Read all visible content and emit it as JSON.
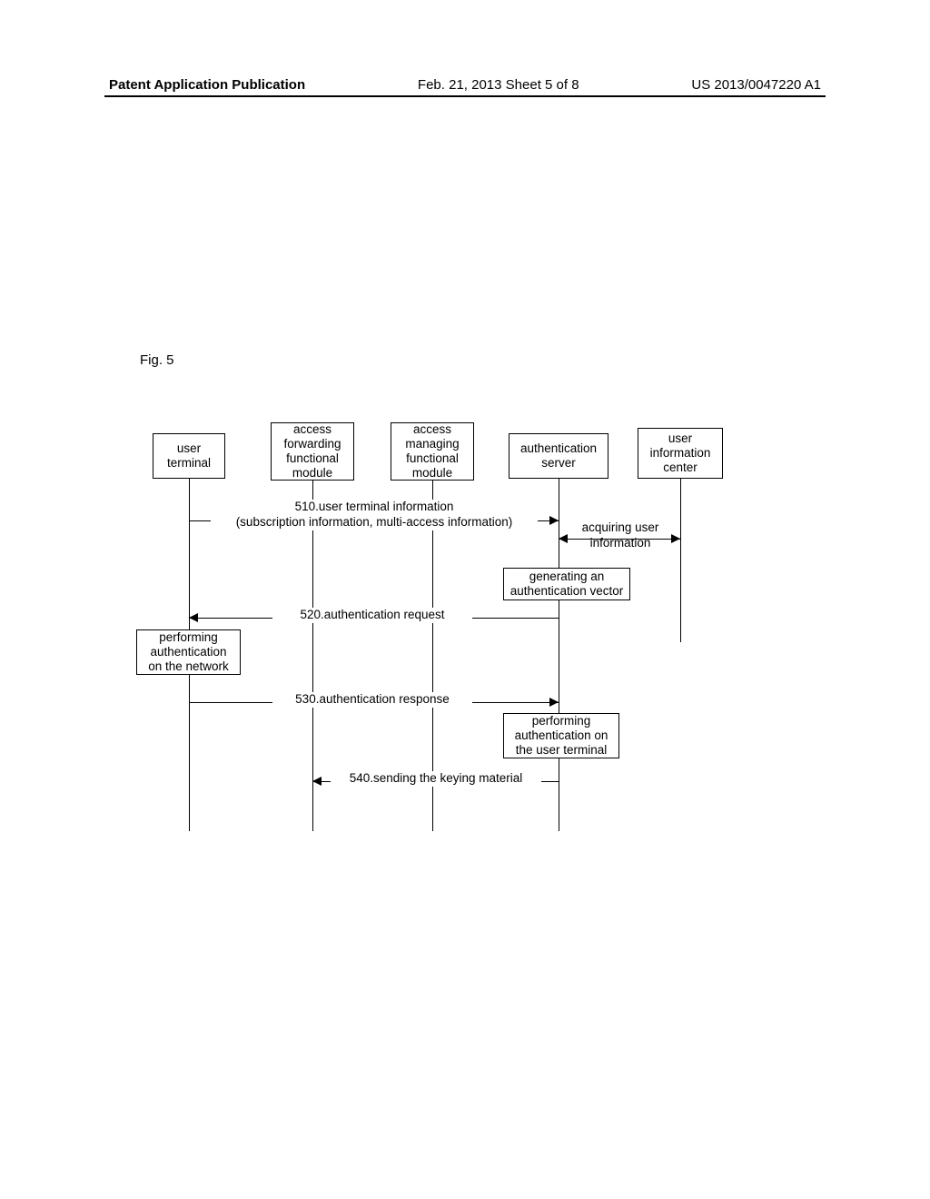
{
  "header": {
    "left": "Patent Application Publication",
    "middle": "Feb. 21, 2013  Sheet 5 of 8",
    "right": "US 2013/0047220 A1"
  },
  "figure_label": "Fig. 5",
  "actors": {
    "user_terminal": "user\nterminal",
    "access_forwarding": "access\nforwarding\nfunctional\nmodule",
    "access_managing": "access\nmanaging\nfunctional\nmodule",
    "auth_server": "authentication\nserver",
    "user_info_center": "user\ninformation\ncenter"
  },
  "messages": {
    "m510_line1": "510.user terminal information",
    "m510_line2": "(subscription information, multi-access information)",
    "acquiring": "acquiring user\ninformation",
    "m520": "520.authentication request",
    "m530": "530.authentication response",
    "m540": "540.sending the keying material"
  },
  "notes": {
    "gen_vector": "generating an\nauthentication vector",
    "perform_net": "performing\nauthentication\non the network",
    "perform_user": "performing\nauthentication on\nthe user terminal"
  }
}
